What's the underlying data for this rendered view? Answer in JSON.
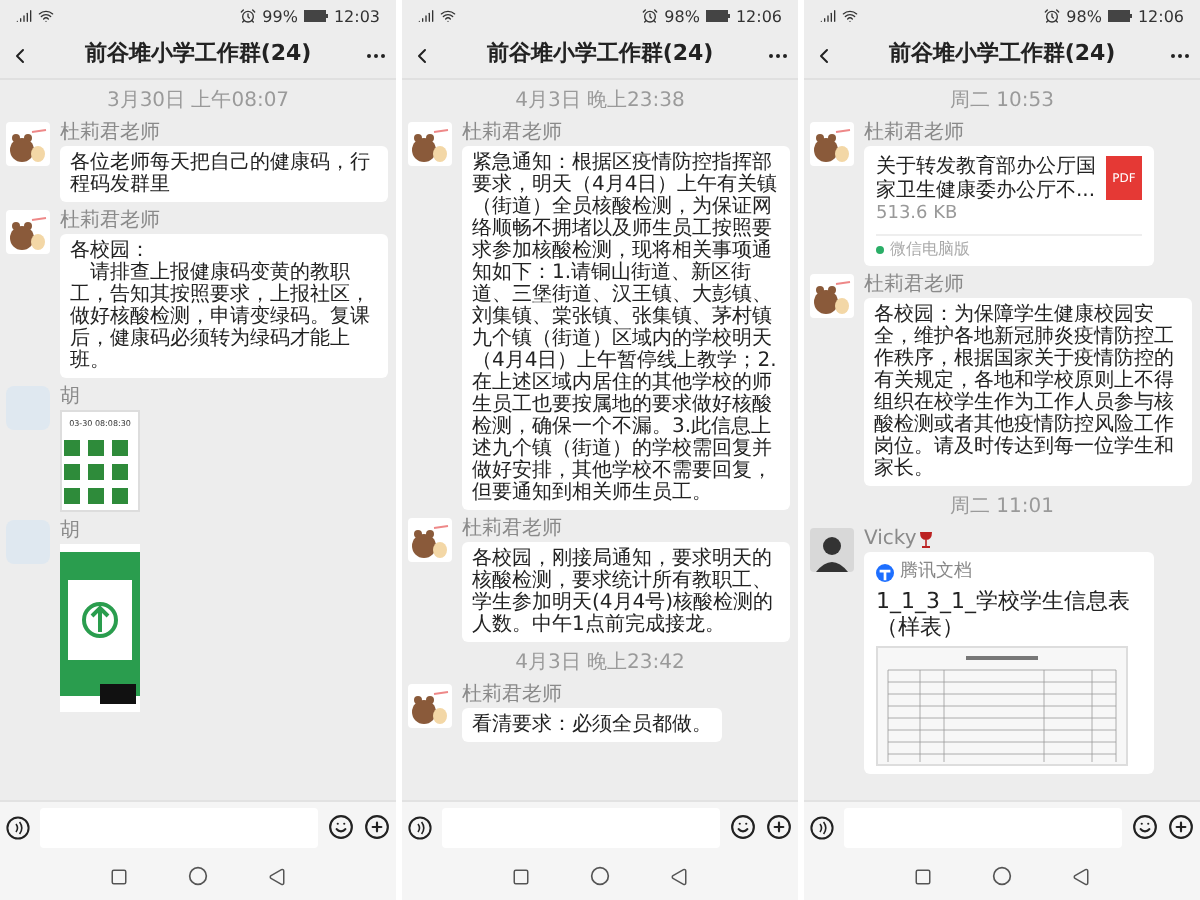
{
  "panels": [
    {
      "status": {
        "battery": "99%",
        "time": "12:03"
      },
      "title": "前谷堆小学工作群(24)",
      "messages": [
        {
          "kind": "time",
          "text": "3月30日 上午08:07"
        },
        {
          "kind": "text",
          "sender": "杜莉君老师",
          "avatar": {
            "kind": "cartoon"
          },
          "text": "各位老师每天把自己的健康码，行程码发群里"
        },
        {
          "kind": "text",
          "sender": "杜莉君老师",
          "avatar": {
            "kind": "cartoon"
          },
          "paragraphs": [
            "各校园：",
            "请排查上报健康码变黄的教职工，告知其按照要求，上报社区，做好核酸检测，申请变绿码。复课后，健康码必须转为绿码才能上班。"
          ]
        },
        {
          "kind": "qr_image",
          "sender": "胡",
          "avatar": {
            "kind": "picture"
          },
          "caption": "03-30 08:08:30"
        },
        {
          "kind": "pass_image",
          "sender": "胡",
          "avatar": {
            "kind": "picture"
          }
        }
      ]
    },
    {
      "status": {
        "battery": "98%",
        "time": "12:06"
      },
      "title": "前谷堆小学工作群(24)",
      "messages": [
        {
          "kind": "time",
          "text": "4月3日 晚上23:38"
        },
        {
          "kind": "text",
          "sender": "杜莉君老师",
          "avatar": {
            "kind": "cartoon"
          },
          "text": "紧急通知：根据区疫情防控指挥部要求，明天（4月4日）上午有关镇（街道）全员核酸检测，为保证网络顺畅不拥堵以及师生员工按照要求参加核酸检测，现将相关事项通知如下：1.请铜山街道、新区街道、三堡街道、汉王镇、大彭镇、刘集镇、棠张镇、张集镇、茅村镇九个镇（街道）区域内的学校明天（4月4日）上午暂停线上教学；2.在上述区域内居住的其他学校的师生员工也要按属地的要求做好核酸检测，确保一个不漏。3.此信息上述九个镇（街道）的学校需回复并做好安排，其他学校不需要回复，但要通知到相关师生员工。"
        },
        {
          "kind": "text",
          "sender": "杜莉君老师",
          "avatar": {
            "kind": "cartoon"
          },
          "text": "各校园，刚接局通知，要求明天的核酸检测，要求统计所有教职工、学生参加明天(4月4号)核酸检测的人数。中午1点前完成接龙。"
        },
        {
          "kind": "time",
          "text": "4月3日 晚上23:42"
        },
        {
          "kind": "text",
          "sender": "杜莉君老师",
          "avatar": {
            "kind": "cartoon"
          },
          "text": "看清要求：必须全员都做。"
        }
      ]
    },
    {
      "status": {
        "battery": "98%",
        "time": "12:06"
      },
      "title": "前谷堆小学工作群(24)",
      "messages": [
        {
          "kind": "time",
          "text": "周二 10:53"
        },
        {
          "kind": "file",
          "sender": "杜莉君老师",
          "avatar": {
            "kind": "cartoon"
          },
          "text": "关于转发教育部办公厅国家卫生健康委办公厅不...",
          "size": "513.6 KB",
          "icon_label": "PDF",
          "source": "微信电脑版"
        },
        {
          "kind": "text",
          "sender": "杜莉君老师",
          "avatar": {
            "kind": "cartoon"
          },
          "text": "各校园：为保障学生健康校园安全，维护各地新冠肺炎疫情防控工作秩序，根据国家关于疫情防控的有关规定，各地和学校原则上不得组织在校学生作为工作人员参与核酸检测或者其他疫情防控风险工作岗位。请及时传达到每一位学生和家长。"
        },
        {
          "kind": "time",
          "text": "周二 11:01"
        },
        {
          "kind": "doc",
          "sender": "Vicky",
          "avatar": {
            "kind": "photo"
          },
          "app": "腾讯文档",
          "text": "1_1_3_1_学校学生信息表（样表）"
        }
      ]
    }
  ]
}
